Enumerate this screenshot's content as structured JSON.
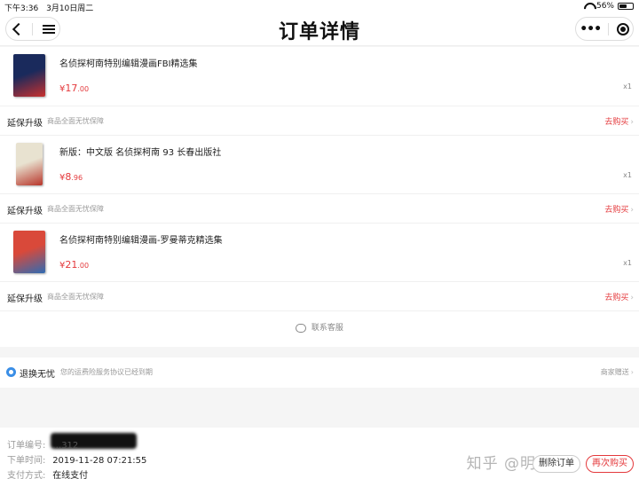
{
  "status_bar": {
    "time": "下午3:36",
    "date": "3月10日周二",
    "battery_percent": "56%",
    "battery_level": 0.56
  },
  "nav": {
    "title": "订单详情"
  },
  "products": [
    {
      "name": "名侦探柯南特别编辑漫画FBI精选集",
      "price_symbol": "¥",
      "price_int": "17",
      "price_dec": ".00",
      "qty": "x1",
      "thumb_colors": [
        "#1a2a5c",
        "#c8302e"
      ]
    },
    {
      "name": "新版：中文版 名侦探柯南 93 长春出版社",
      "price_symbol": "¥",
      "price_int": "8",
      "price_dec": ".96",
      "qty": "x1",
      "thumb_colors": [
        "#e8e2d0",
        "#b8352a"
      ]
    },
    {
      "name": "名侦探柯南特别编辑漫画-罗曼蒂克精选集",
      "price_symbol": "¥",
      "price_int": "21",
      "price_dec": ".00",
      "qty": "x1",
      "thumb_colors": [
        "#d9493a",
        "#2f6bb3"
      ]
    }
  ],
  "warranty": {
    "label": "延保升级",
    "desc": "商品全面无忧保障",
    "link": "去购买"
  },
  "service": {
    "label": "联系客服"
  },
  "guarantee": {
    "title": "退换无忧",
    "desc": "您的运费险服务协议已经到期",
    "right": "商家赠送"
  },
  "order_info": {
    "number_label": "订单编号:",
    "number_value": "…312",
    "time_label": "下单时间:",
    "time_value": "2019-11-28 07:21:55",
    "pay_label": "支付方式:",
    "pay_value": "在线支付"
  },
  "actions": {
    "delete": "删除订单",
    "rebuy": "再次购买"
  },
  "watermark": "知乎 @明泽予",
  "colors": {
    "accent_red": "#e4393c",
    "guarantee_blue": "#3a8ee6"
  }
}
